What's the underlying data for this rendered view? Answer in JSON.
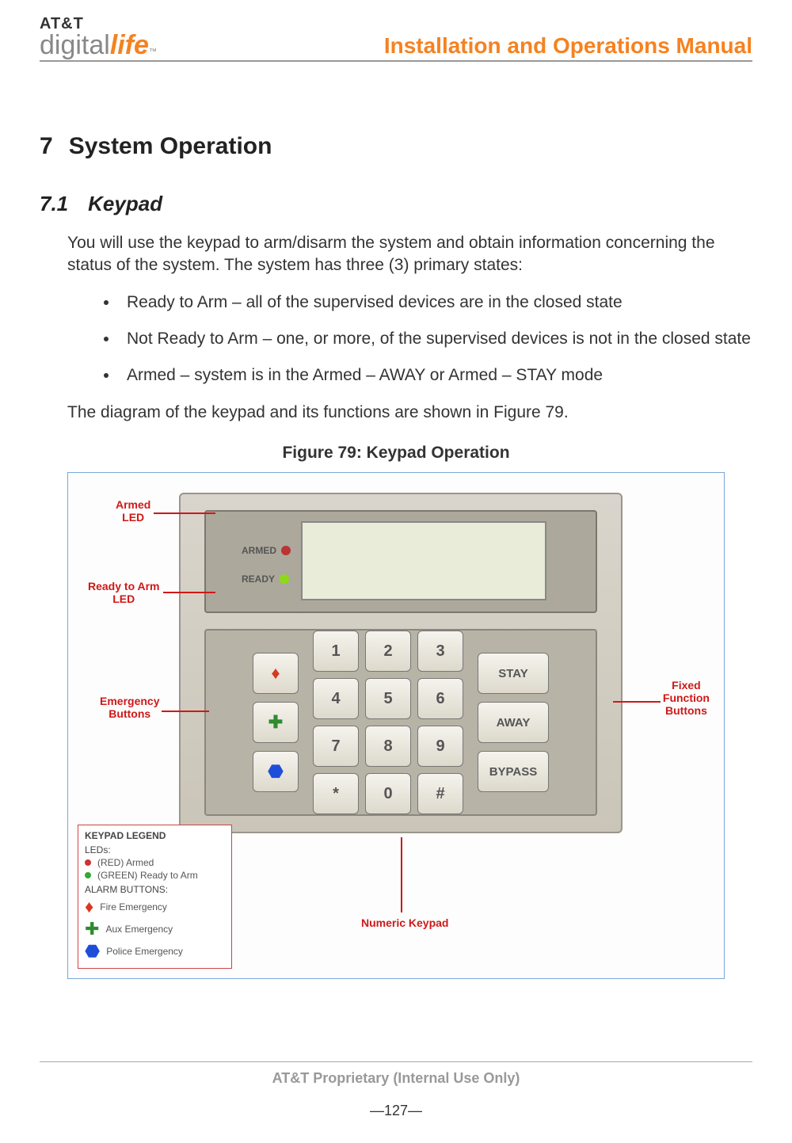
{
  "header": {
    "logo_att": "AT&T",
    "logo_digital": "digital",
    "logo_life": "life",
    "tm": "™",
    "doc_title": "Installation and Operations Manual"
  },
  "section": {
    "h1_num": "7",
    "h1_text": "System Operation",
    "h2_num": "7.1",
    "h2_text": "Keypad",
    "intro": "You will use the keypad to arm/disarm the system and obtain information concerning the status of the system. The system has three (3) primary states:",
    "states": [
      "Ready to Arm – all of the supervised devices are in the closed state",
      "Not Ready to Arm – one, or more, of the supervised devices is not in the closed state",
      "Armed – system is in the Armed – AWAY or Armed – STAY mode"
    ],
    "post": "The diagram of the keypad and its functions are shown in Figure 79.",
    "figure_title": "Figure 79: Keypad Operation"
  },
  "keypad": {
    "armed_label": "ARMED",
    "ready_label": "READY",
    "numeric": [
      "1",
      "2",
      "3",
      "4",
      "5",
      "6",
      "7",
      "8",
      "9",
      "*",
      "0",
      "#"
    ],
    "fn": {
      "stay": "STAY",
      "away": "AWAY",
      "bypass": "BYPASS"
    }
  },
  "annotations": {
    "armed_led": "Armed\nLED",
    "ready_led": "Ready to Arm\nLED",
    "emergency": "Emergency\nButtons",
    "numeric": "Numeric Keypad",
    "fixed": "Fixed\nFunction\nButtons"
  },
  "legend": {
    "title": "KEYPAD LEGEND",
    "leds_label": "LEDs:",
    "leds": [
      {
        "color": "red",
        "text": "(RED) Armed"
      },
      {
        "color": "green",
        "text": "(GREEN) Ready to Arm"
      }
    ],
    "alarm_label": "ALARM BUTTONS:",
    "alarm": [
      {
        "icon": "fire",
        "text": "Fire Emergency"
      },
      {
        "icon": "aux",
        "text": "Aux Emergency"
      },
      {
        "icon": "police",
        "text": "Police Emergency"
      }
    ]
  },
  "footer": {
    "proprietary": "AT&T Proprietary (Internal Use Only)",
    "page": "—127—"
  }
}
